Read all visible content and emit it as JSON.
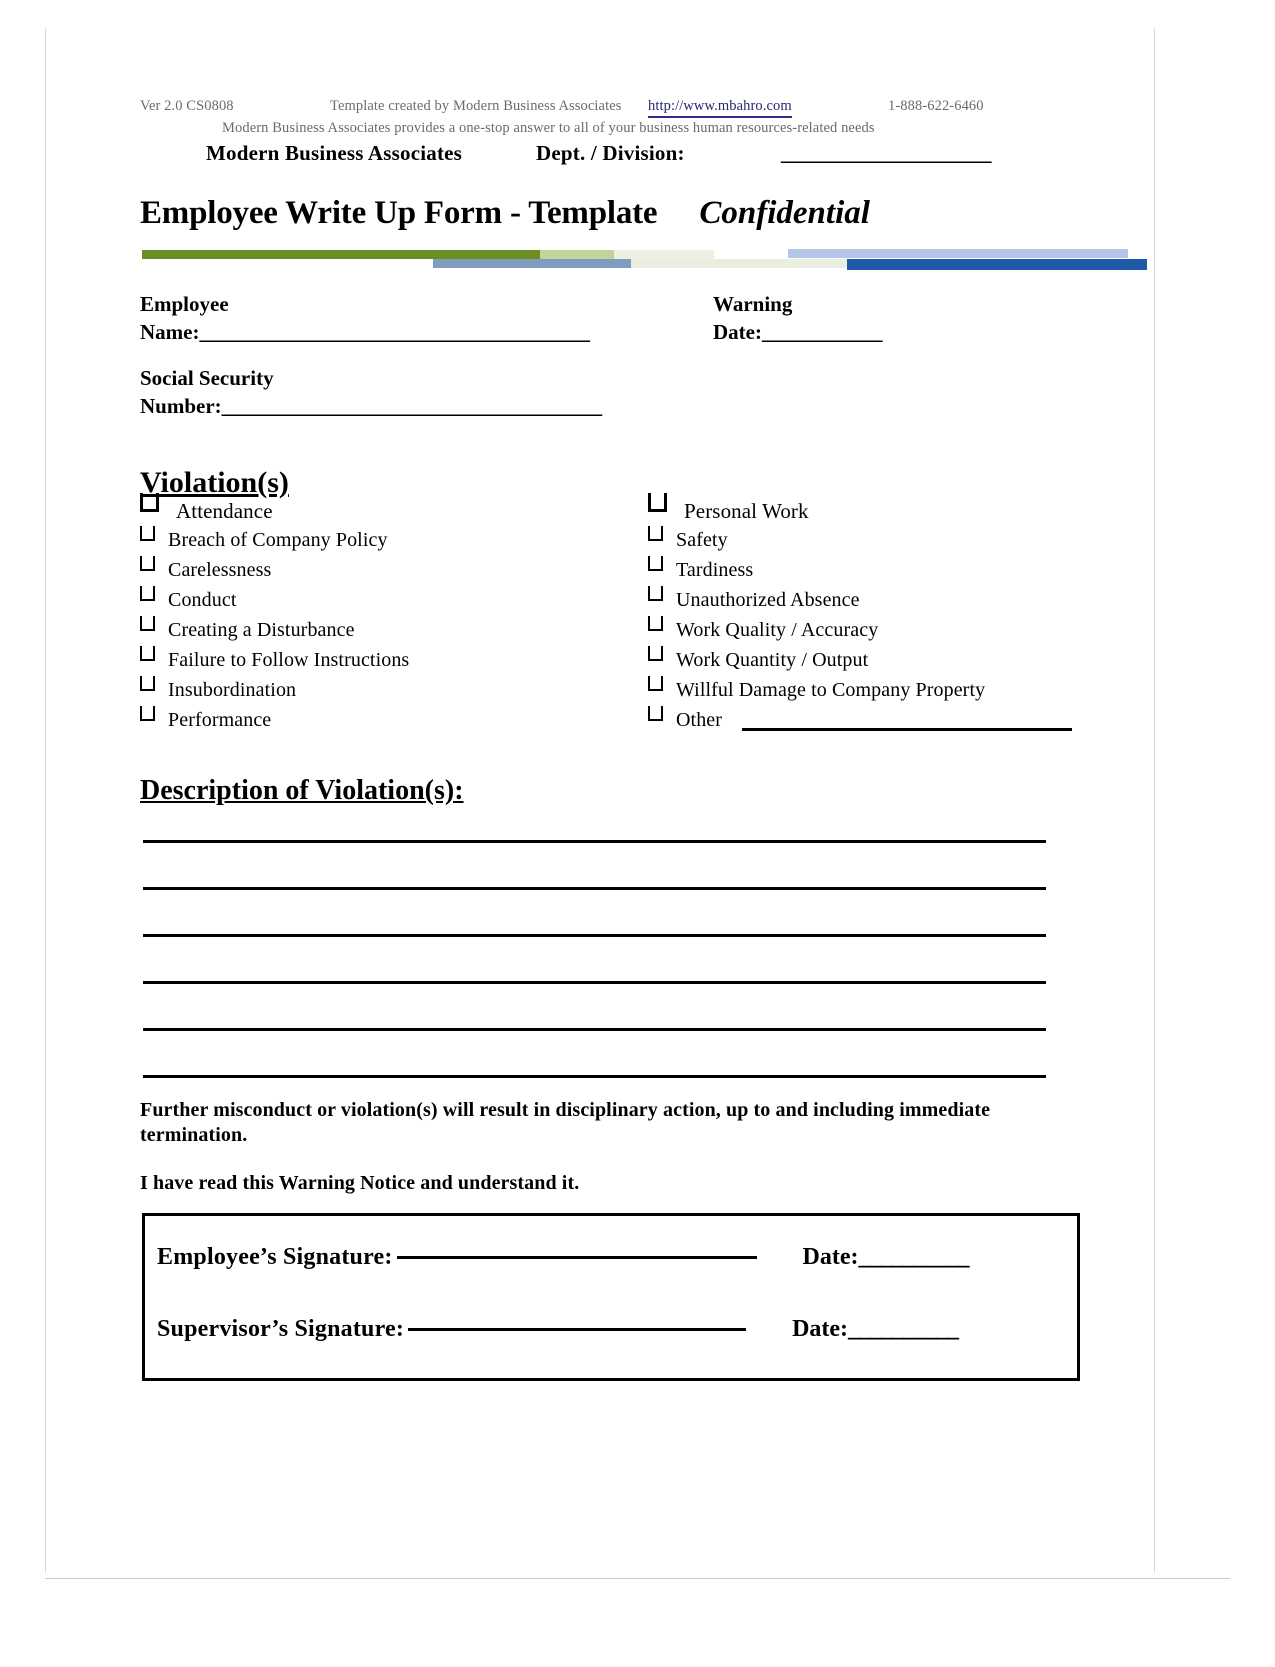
{
  "header": {
    "version": "Ver 2.0 CS0808",
    "template_credit": "Template created by Modern Business Associates",
    "website": "http://www.mbahro.com",
    "phone": "1-888-622-6460",
    "tagline": "Modern Business Associates provides a one-stop answer to all of your business human resources-related needs",
    "company_name": "Modern Business Associates",
    "dept_label": "Dept. / Division:",
    "dept_blank": "_____________________"
  },
  "title": {
    "main": "Employee Write Up Form - Template",
    "confidential": "Confidential"
  },
  "fields": {
    "employee_name_label_line1": "Employee",
    "employee_name_label_line2": "Name:",
    "employee_name_blank": "_______________________________________",
    "warning_date_label_line1": "Warning",
    "warning_date_label_line2": "Date:",
    "warning_date_blank": "____________",
    "ssn_label_line1": "Social Security",
    "ssn_label_line2": "Number:",
    "ssn_blank": "______________________________________"
  },
  "violations": {
    "heading": "Violation(s)",
    "left_column": [
      "Attendance",
      "Breach of Company Policy",
      "Carelessness",
      "Conduct",
      "Creating a Disturbance",
      "Failure to Follow Instructions",
      "Insubordination",
      "Performance"
    ],
    "right_column": [
      "Personal Work",
      "Safety",
      "Tardiness",
      "Unauthorized Absence",
      "Work Quality / Accuracy",
      "Work Quantity / Output",
      "Willful Damage to Company Property",
      "Other"
    ]
  },
  "description": {
    "heading": "Description of Violation(s):",
    "rule_count": 6
  },
  "notices": {
    "misconduct": "Further misconduct or violation(s) will result in disciplinary action, up to and including immediate termination.",
    "acknowledgement": "I have read this Warning Notice and understand it."
  },
  "signature": {
    "employee_label": "Employee’s Signature:",
    "supervisor_label": "Supervisor’s Signature:",
    "date_label": "Date:",
    "date_blank": "__________"
  },
  "colors": {
    "bar_green": "#6b8e23",
    "bar_green_pale": "#c3d39a",
    "bar_cream": "#eef0e2",
    "bar_blue_pale": "#b3c6e7",
    "bar_steel": "#7f9bbd",
    "bar_blue_dark": "#1f5aa8",
    "link": "#262674",
    "microtext": "#6b6b6b"
  }
}
